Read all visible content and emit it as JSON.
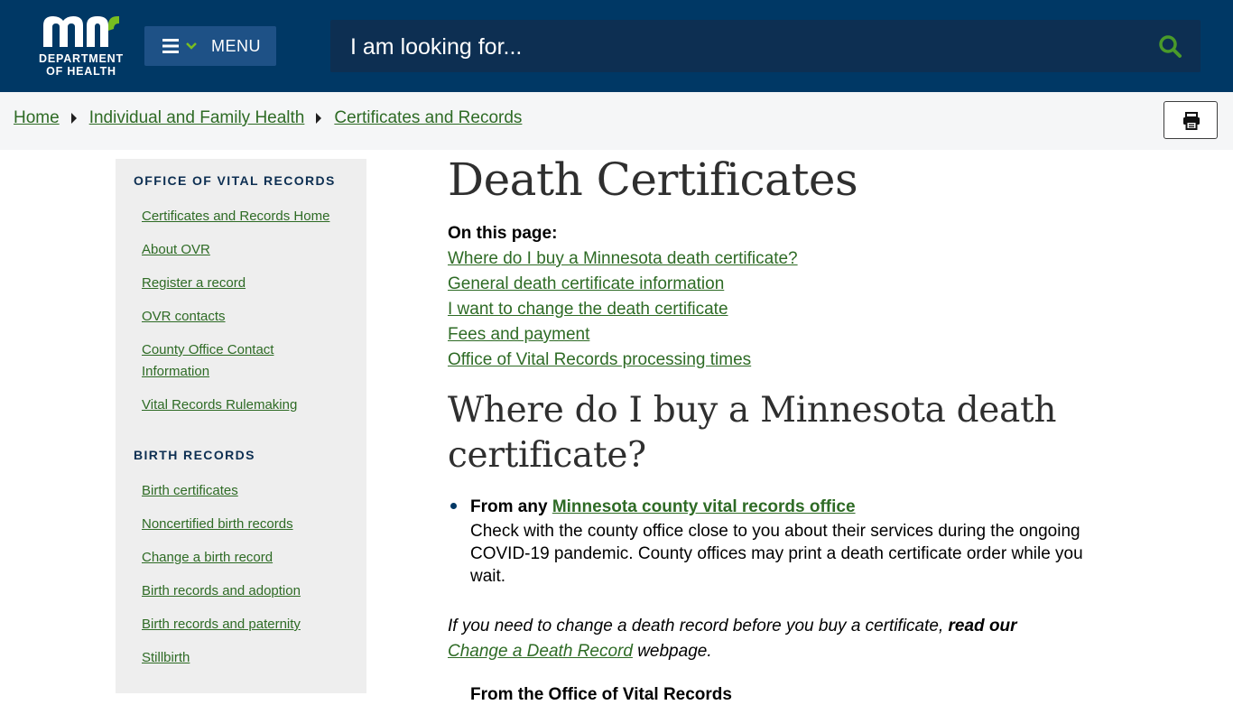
{
  "header": {
    "logo_text_line1": "DEPARTMENT",
    "logo_text_line2": "OF HEALTH",
    "menu_label": "MENU",
    "search_placeholder": "I am looking for..."
  },
  "breadcrumb": [
    "Home",
    "Individual and Family Health",
    "Certificates and Records"
  ],
  "sidebar": {
    "sections": [
      {
        "heading": "OFFICE OF VITAL RECORDS",
        "links": [
          "Certificates and Records Home",
          "About OVR",
          "Register a record",
          "OVR contacts",
          "County Office Contact Information",
          "Vital Records Rulemaking"
        ]
      },
      {
        "heading": "BIRTH RECORDS",
        "links": [
          "Birth certificates",
          "Noncertified birth records",
          "Change a birth record",
          "Birth records and adoption",
          "Birth records and paternity",
          "Stillbirth"
        ]
      }
    ]
  },
  "main": {
    "title": "Death Certificates",
    "on_this_page": "On this page:",
    "toc": [
      "Where do I buy a Minnesota death certificate? ",
      "General death certificate information",
      "I want to change the death certificate",
      "Fees and payment",
      "Office of Vital Records processing times"
    ],
    "section_heading": "Where do I buy a Minnesota death certificate?",
    "item_lead": "From any",
    "item_link": "Minnesota county vital records office",
    "item_desc": "Check with the county office close to you about their services during the ongoing COVID-19 pandemic. County offices may print a death certificate order while you wait.",
    "note_before": "If you need to change a death record before you buy a certificate, ",
    "note_bold": "read our",
    "note_link": "Change a Death Record",
    "note_after": " webpage.",
    "next_item": "From the Office of Vital Records"
  },
  "colors": {
    "header_bg": "#003865",
    "menu_bg": "#1e5186",
    "search_bg": "#0d2f52",
    "link_green": "#2e6b25",
    "logo_green": "#78be21"
  }
}
